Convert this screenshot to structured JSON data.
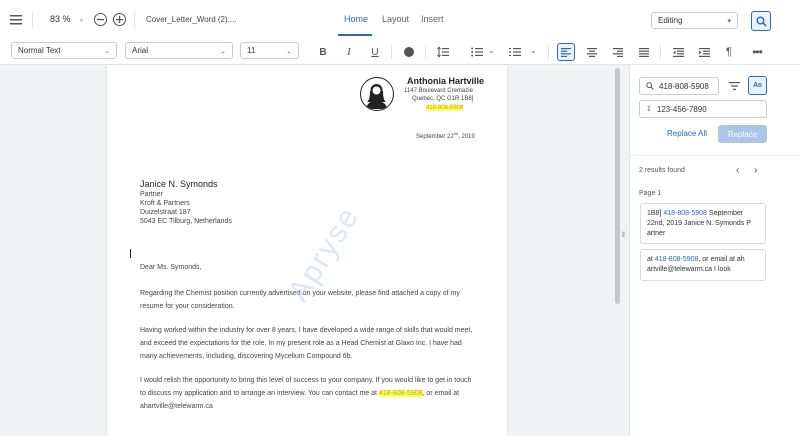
{
  "topbar": {
    "zoom": "83 %",
    "file_name": "Cover_Letter_Word (2)....",
    "tabs": [
      "Home",
      "Layout",
      "Insert"
    ],
    "mode": "Editing"
  },
  "toolbar": {
    "style": "Normal Text",
    "font": "Arial",
    "size": "11"
  },
  "letter": {
    "name": "Anthonia Hartville",
    "address1": "1147 Boulevard Cremazie",
    "address2": "Quebec, QC G1R 1B8]",
    "phone": "418-808-5908",
    "date_main": "September 22",
    "date_sup": "nd",
    "date_year": ", 2019",
    "recipient_name": "Janice N. Symonds",
    "recipient_lines": [
      "Partner",
      "Kroft & Partners",
      "Duizelstraat 187",
      "5043 EC Tilburg, Netherlands"
    ],
    "salutation": "Dear Ms. Symonds,",
    "body_lines": [
      "Regarding the Chemist position currently advertised on your website, please find attached a copy of my",
      "resume for your consideration.",
      "Having worked within the industry for over 8 years, I have developed a wide range of skills that would meet,",
      "and exceed the expectations for the role. In my present role as a Head Chemist at Glaxo Inc. I have had",
      "many achievements, including, discovering Mycelium Compound 6b.",
      "I would relish the opportunity to bring this level of success to your company. If you would like to get in touch",
      "to discuss my application and to arrange an interview. You can contact me at ",
      ", or email at",
      "ahartville@telewarm.ca"
    ],
    "watermark": "Apryse"
  },
  "panel": {
    "search_value": "418-808-5908",
    "replace_value": "123-456-7890",
    "replace_all": "Replace All",
    "replace": "Replace",
    "results_count": "2 results found",
    "page_label": "Page 1",
    "results": [
      {
        "pre": "1B8] ",
        "match": "418-808-5908",
        "post": " September 22nd, 2019 Janice N. Symonds P artner"
      },
      {
        "pre": "at ",
        "match": "418-808-5908",
        "post": ", or email at ah artville@telewarm.ca I look"
      }
    ]
  },
  "colors": {
    "accent": "#2b6bb0",
    "highlight": "#ffff66"
  }
}
